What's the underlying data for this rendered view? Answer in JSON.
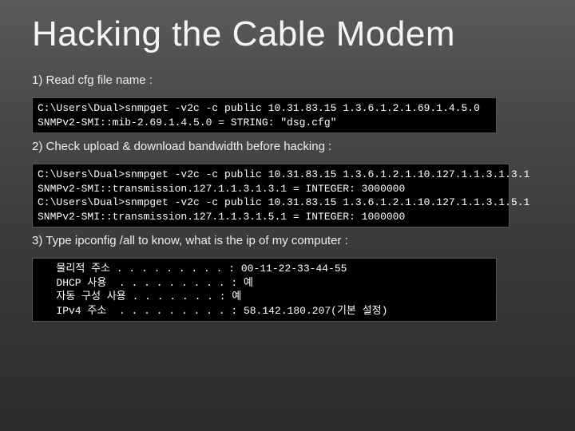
{
  "title": "Hacking the Cable Modem",
  "step1": {
    "label": "1) Read cfg file name :",
    "term": "C:\\Users\\Dual>snmpget -v2c -c public 10.31.83.15 1.3.6.1.2.1.69.1.4.5.0\nSNMPv2-SMI::mib-2.69.1.4.5.0 = STRING: \"dsg.cfg\""
  },
  "step2": {
    "label": "2) Check upload & download bandwidth before hacking :",
    "term": "C:\\Users\\Dual>snmpget -v2c -c public 10.31.83.15 1.3.6.1.2.1.10.127.1.1.3.1.3.1\nSNMPv2-SMI::transmission.127.1.1.3.1.3.1 = INTEGER: 3000000\nC:\\Users\\Dual>snmpget -v2c -c public 10.31.83.15 1.3.6.1.2.1.10.127.1.1.3.1.5.1\nSNMPv2-SMI::transmission.127.1.1.3.1.5.1 = INTEGER: 1000000"
  },
  "step3": {
    "label": "3) Type ipconfig /all to know, what is the ip of my computer :",
    "term": "   물리적 주소 . . . . . . . . . : 00-11-22-33-44-55\n   DHCP 사용  . . . . . . . . . : 예\n   자동 구성 사용 . . . . . . . : 예\n   IPv4 주소  . . . . . . . . . : 58.142.180.207(기본 설정)"
  }
}
